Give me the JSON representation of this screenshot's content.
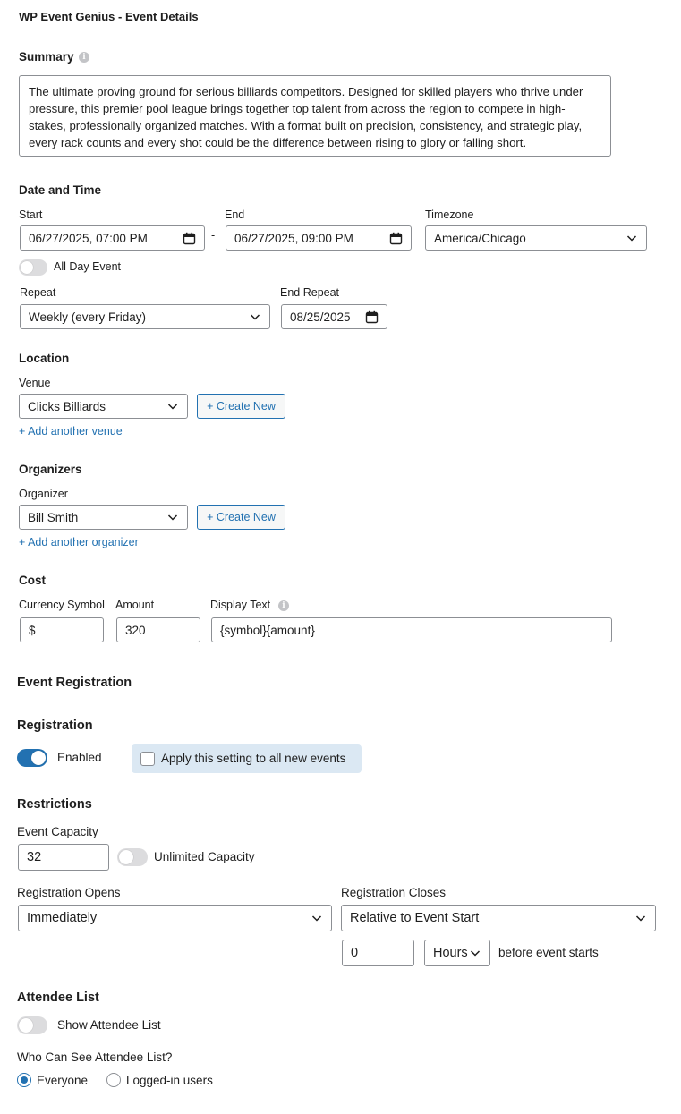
{
  "title": "WP Event Genius - Event Details",
  "summary": {
    "label": "Summary",
    "text": "The ultimate proving ground for serious billiards competitors. Designed for skilled players who thrive under pressure, this premier pool league brings together top talent from across the region to compete in high-stakes, professionally organized matches. With a format built on precision, consistency, and strategic play, every rack counts and every shot could be the difference between rising to glory or falling short."
  },
  "datetime": {
    "heading": "Date and Time",
    "start_label": "Start",
    "start_value": "06/27/2025, 07:00 PM",
    "separator": "-",
    "end_label": "End",
    "end_value": "06/27/2025, 09:00 PM",
    "timezone_label": "Timezone",
    "timezone_value": "America/Chicago",
    "all_day_label": "All Day Event",
    "all_day_enabled": false,
    "repeat_label": "Repeat",
    "repeat_value": "Weekly (every Friday)",
    "end_repeat_label": "End Repeat",
    "end_repeat_value": "08/25/2025"
  },
  "location": {
    "heading": "Location",
    "venue_label": "Venue",
    "venue_value": "Clicks Billiards",
    "create_new_label": "+ Create New",
    "add_link": "+ Add another venue"
  },
  "organizers": {
    "heading": "Organizers",
    "organizer_label": "Organizer",
    "organizer_value": "Bill Smith",
    "create_new_label": "+ Create New",
    "add_link": "+ Add another organizer"
  },
  "cost": {
    "heading": "Cost",
    "currency_label": "Currency Symbol",
    "currency_value": "$",
    "amount_label": "Amount",
    "amount_value": "320",
    "display_text_label": "Display Text",
    "display_text_value": "{symbol}{amount}"
  },
  "event_registration": {
    "heading": "Event Registration",
    "registration_heading": "Registration",
    "enabled_label": "Enabled",
    "enabled": true,
    "apply_all_label": "Apply this setting to all new events",
    "apply_all_checked": false
  },
  "restrictions": {
    "heading": "Restrictions",
    "capacity_label": "Event Capacity",
    "capacity_value": "32",
    "unlimited_label": "Unlimited Capacity",
    "unlimited_enabled": false,
    "opens_label": "Registration Opens",
    "opens_value": "Immediately",
    "closes_label": "Registration Closes",
    "closes_value": "Relative to Event Start",
    "offset_value": "0",
    "unit_value": "Hours",
    "before_text": "before event starts"
  },
  "attendees": {
    "heading": "Attendee List",
    "show_label": "Show Attendee List",
    "show_enabled": false,
    "who_label": "Who Can See Attendee List?",
    "options": [
      "Everyone",
      "Logged-in users"
    ],
    "selected": "Everyone"
  },
  "colors": {
    "accent": "#2271b1",
    "border": "#8c8f94",
    "toggle_off": "#dcdcde",
    "apply_bg": "#dbe8f3"
  },
  "icons": {
    "info": "info-icon",
    "chevron": "chevron-down-icon",
    "calendar": "calendar-icon"
  }
}
